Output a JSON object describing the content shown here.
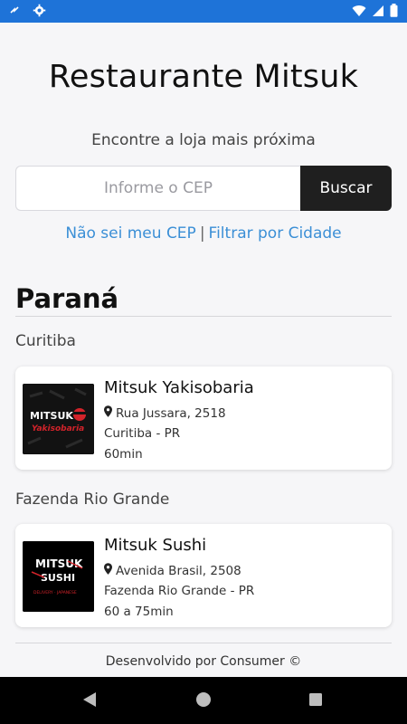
{
  "status_bar": {
    "left_icons": [
      "notification-icon",
      "gear-icon"
    ],
    "right_icons": [
      "wifi-icon",
      "signal-icon",
      "battery-icon"
    ]
  },
  "app": {
    "title": "Restaurante Mitsuk",
    "subtitle": "Encontre a loja mais próxima",
    "search": {
      "placeholder": "Informe o CEP",
      "value": "",
      "button_label": "Buscar"
    },
    "links": {
      "cep_unknown": "Não sei meu CEP",
      "separator": "|",
      "filter_city": "Filtrar por Cidade"
    }
  },
  "state": {
    "name": "Paraná"
  },
  "groups": [
    {
      "city": "Curitiba",
      "store": {
        "name": "Mitsuk Yakisobaria",
        "address": "Rua Jussara, 2518",
        "city_line": "Curitiba - PR",
        "time": "60min",
        "logo": {
          "line1": "MITSUK",
          "line2": "Yakisobaria",
          "accent": "#d2232a"
        }
      }
    },
    {
      "city": "Fazenda Rio Grande",
      "store": {
        "name": "Mitsuk Sushi",
        "address": "Avenida Brasil, 2508",
        "city_line": "Fazenda Rio Grande - PR",
        "time": "60 a 75min",
        "logo": {
          "line1": "MITSUK",
          "line2": "SUSHI",
          "line3": "DELIVERY · JAPANESE",
          "accent": "#d2232a"
        }
      }
    }
  ],
  "footer": {
    "text": "Desenvolvido por Consumer ©"
  },
  "nav_bar": {
    "buttons": [
      "back-icon",
      "home-icon",
      "recents-icon"
    ]
  },
  "colors": {
    "status_bar": "#1e73d8",
    "link": "#3b8fd6",
    "button": "#1f1f1f"
  }
}
